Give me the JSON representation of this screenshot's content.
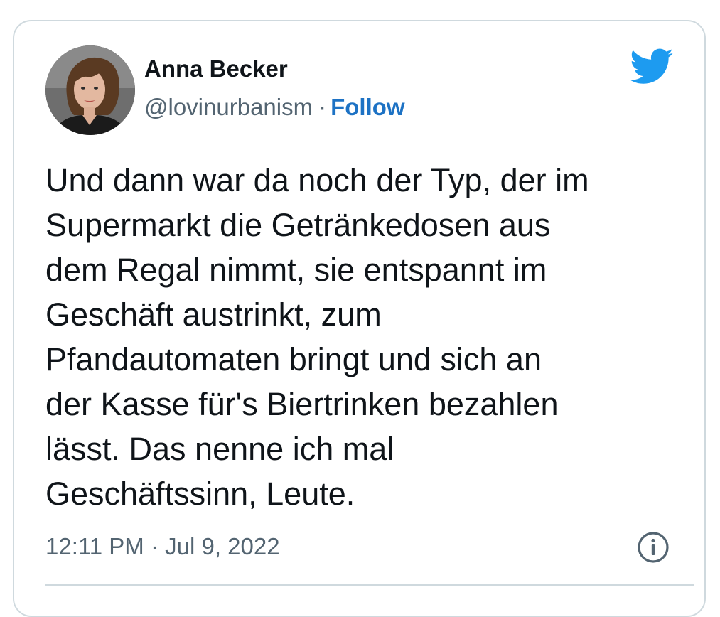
{
  "author": {
    "display_name": "Anna Becker",
    "handle": "@lovinurbanism",
    "separator": "·",
    "follow_label": "Follow"
  },
  "tweet": {
    "text": "Und dann war da noch der Typ, der im\nSupermarkt die Getränkedosen aus\ndem Regal nimmt, sie entspannt im\nGeschäft austrinkt, zum\nPfandautomaten bringt und sich an\nder Kasse für's Biertrinken bezahlen\nlässt. Das nenne ich mal\nGeschäftssinn, Leute.",
    "timestamp": "12:11 PM · Jul 9, 2022"
  },
  "icons": {
    "brand": "twitter-bird-icon",
    "info": "info-icon"
  },
  "colors": {
    "brand": "#1d9bf0",
    "follow": "#1d72c4",
    "secondary_text": "#536471",
    "border": "#cfd9de"
  }
}
